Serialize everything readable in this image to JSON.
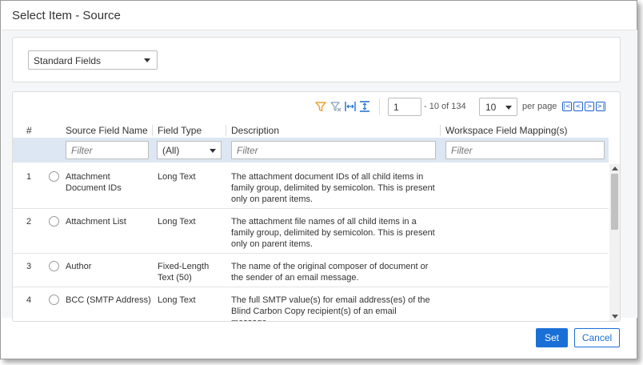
{
  "dialog": {
    "title": "Select Item - Source"
  },
  "field_set": {
    "selected": "Standard Fields"
  },
  "toolbar": {
    "page_value": "1",
    "range_text": "- 10 of 134",
    "per_page_value": "10",
    "per_page_label": "per page",
    "pager": {
      "first": "|<",
      "prev": "<",
      "next": ">",
      "last": ">|"
    }
  },
  "columns": {
    "number": "#",
    "source_field_name": "Source Field Name",
    "field_type": "Field Type",
    "description": "Description",
    "workspace_mapping": "Workspace Field Mapping(s)"
  },
  "filters": {
    "source_placeholder": "Filter",
    "field_type_value": "(All)",
    "description_placeholder": "Filter",
    "mapping_placeholder": "Filter"
  },
  "rows": [
    {
      "num": "1",
      "name": "Attachment Document IDs",
      "type": "Long Text",
      "description": "The attachment document IDs of all child items in family group, delimited by semicolon. This is present only on parent items.",
      "mapping": ""
    },
    {
      "num": "2",
      "name": "Attachment List",
      "type": "Long Text",
      "description": "The attachment file names of all child items in a family group, delimited by semicolon. This is present only on parent items.",
      "mapping": ""
    },
    {
      "num": "3",
      "name": "Author",
      "type": "Fixed-Length Text (50)",
      "description": "The name of the original composer of document or the sender of an email message.",
      "mapping": ""
    },
    {
      "num": "4",
      "name": "BCC (SMTP Address)",
      "type": "Long Text",
      "description": "The full SMTP value(s) for email address(es) of the Blind Carbon Copy recipient(s) of an email message.",
      "mapping": ""
    }
  ],
  "footer": {
    "set_label": "Set",
    "cancel_label": "Cancel"
  },
  "colors": {
    "accent": "#1a6fd6",
    "filter_row": "#dde7f3",
    "filter_icon": "#f0a030"
  }
}
